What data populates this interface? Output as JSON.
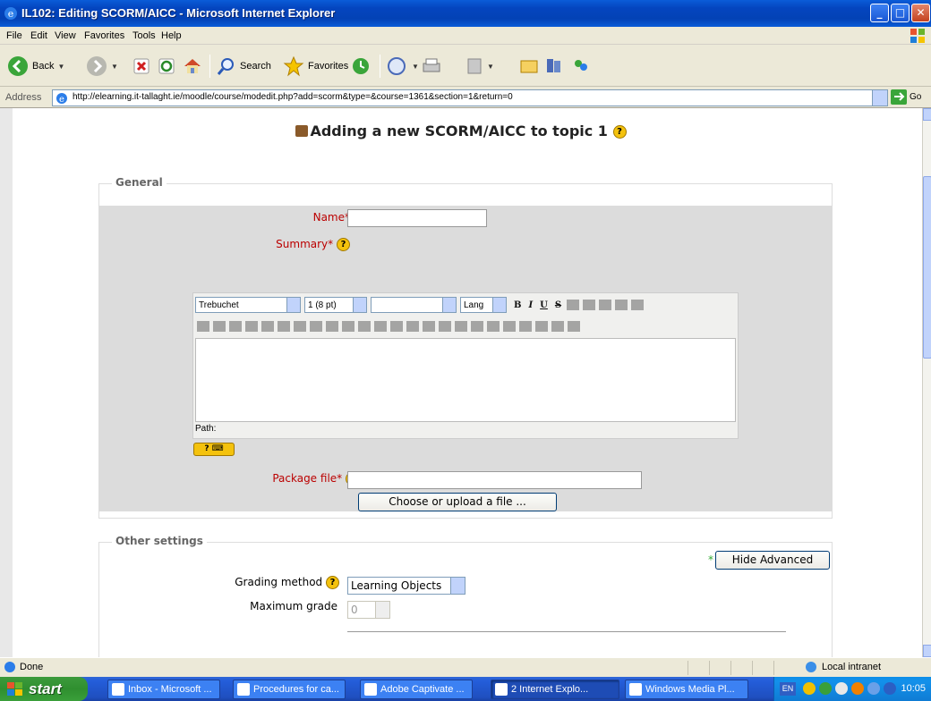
{
  "window": {
    "title": "IL102: Editing SCORM/AICC - Microsoft Internet Explorer"
  },
  "menu": [
    "File",
    "Edit",
    "View",
    "Favorites",
    "Tools",
    "Help"
  ],
  "toolbar": {
    "back": "Back",
    "search": "Search",
    "favorites": "Favorites"
  },
  "address": {
    "label": "Address",
    "url": "http://elearning.it-tallaght.ie/moodle/course/modedit.php?add=scorm&type=&course=1361&section=1&return=0",
    "go": "Go"
  },
  "page": {
    "heading": "Adding a new SCORM/AICC to topic 1",
    "general": {
      "legend": "General",
      "name_label": "Name",
      "summary_label": "Summary",
      "required_mark": "*",
      "editor": {
        "font": "Trebuchet",
        "size": "1 (8 pt)",
        "style": "",
        "lang": "Lang",
        "bold": "B",
        "italic": "I",
        "underline": "U",
        "strike": "S",
        "path_label": "Path:"
      },
      "package_label": "Package file",
      "package_value": "",
      "choose_button": "Choose or upload a file ..."
    },
    "other": {
      "legend": "Other settings",
      "hide_advanced": "Hide Advanced",
      "grading_label": "Grading method",
      "grading_value": "Learning Objects",
      "max_grade_label": "Maximum grade",
      "max_grade_value": "0"
    }
  },
  "status": {
    "text": "Done",
    "zone": "Local intranet"
  },
  "taskbar": {
    "start": "start",
    "tasks": [
      "Inbox - Microsoft ...",
      "Procedures for ca...",
      "Adobe Captivate ...",
      "2 Internet Explo...",
      "Windows Media Pl..."
    ],
    "lang": "EN",
    "clock": "10:05"
  },
  "colors": {
    "required": "#bb0000",
    "title_bar": "#0445bf",
    "taskbar": "#245edb",
    "start": "#2f8f2f"
  }
}
